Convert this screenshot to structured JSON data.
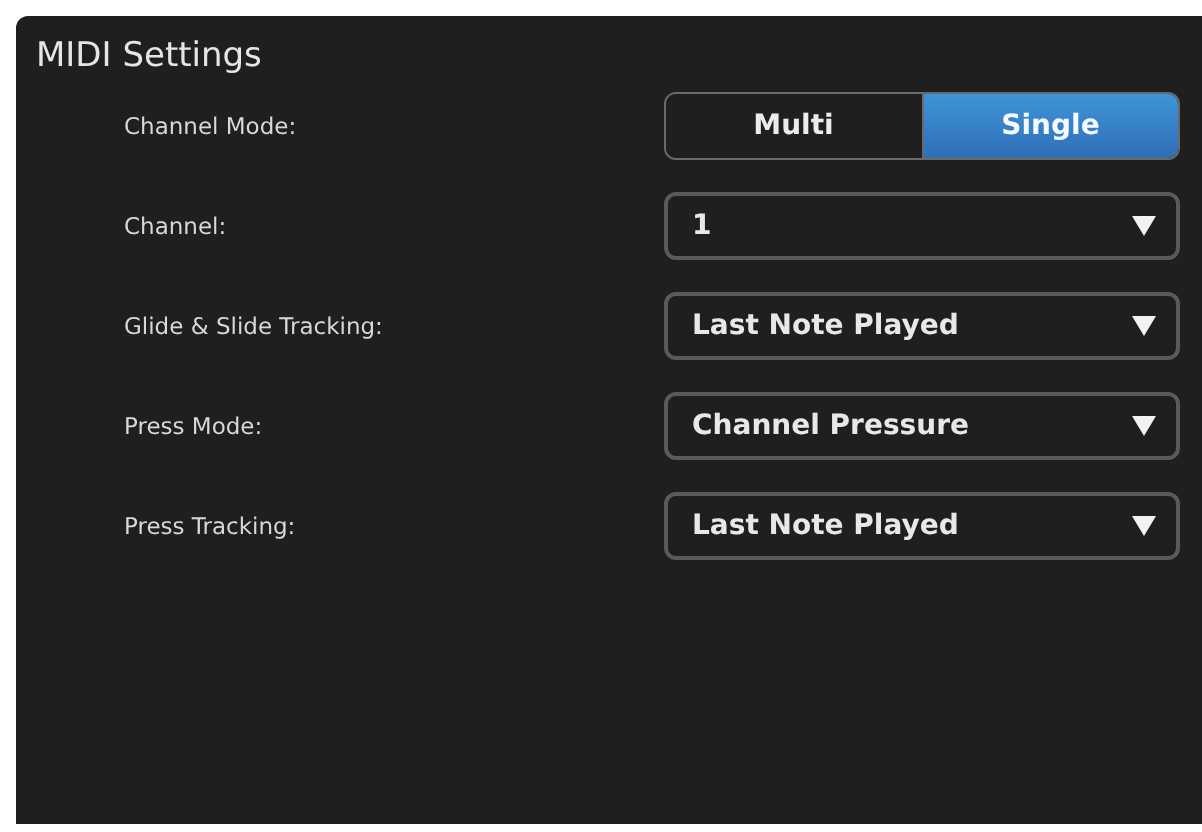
{
  "title": "MIDI Settings",
  "settings": [
    {
      "kind": "segmented",
      "label": "Channel Mode:",
      "options": [
        {
          "label": "Multi",
          "selected": false
        },
        {
          "label": "Single",
          "selected": true
        }
      ]
    },
    {
      "kind": "dropdown",
      "label": "Channel:",
      "value": "1"
    },
    {
      "kind": "dropdown",
      "label": "Glide & Slide Tracking:",
      "value": "Last Note Played"
    },
    {
      "kind": "dropdown",
      "label": "Press Mode:",
      "value": "Channel Pressure"
    },
    {
      "kind": "dropdown",
      "label": "Press Tracking:",
      "value": "Last Note Played"
    }
  ]
}
